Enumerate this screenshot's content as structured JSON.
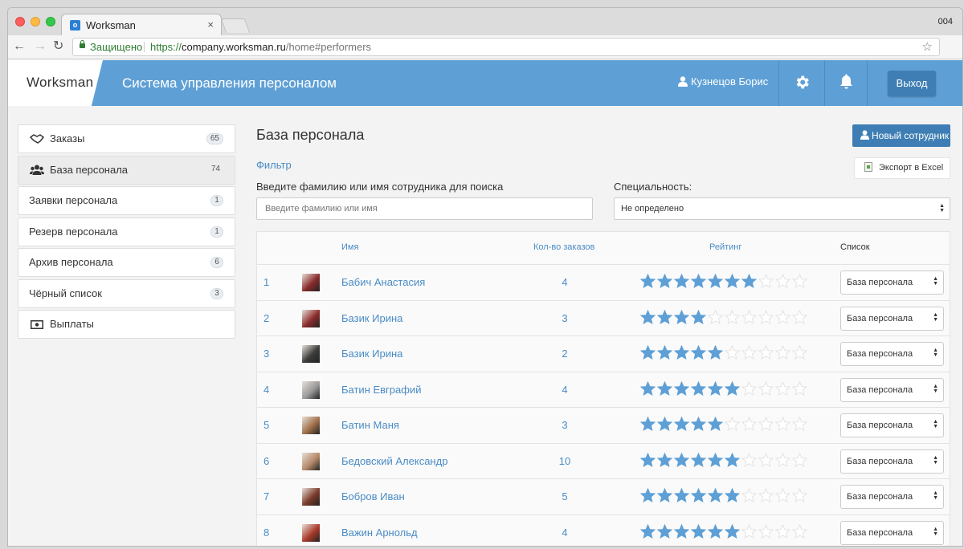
{
  "browser": {
    "tab_title": "Worksman",
    "tab_close": "×",
    "window_label": "004",
    "secure_label": "Защищено",
    "url_proto": "https://",
    "url_host": "company.worksman.ru",
    "url_path": "/home#performers"
  },
  "header": {
    "logo": "Worksman",
    "title": "Система управления персоналом",
    "user_name": "Кузнецов Борис",
    "logout_label": "Выход",
    "accent_color": "#5ea0d6"
  },
  "sidebar": {
    "items": [
      {
        "label": "Заказы",
        "icon": "handshake-icon",
        "badge": "65",
        "active": false
      },
      {
        "label": "База персонала",
        "icon": "users-icon",
        "badge": "74",
        "active": true
      },
      {
        "label": "Заявки персонала",
        "icon": "",
        "badge": "1",
        "active": false
      },
      {
        "label": "Резерв персонала",
        "icon": "",
        "badge": "1",
        "active": false
      },
      {
        "label": "Архив персонала",
        "icon": "",
        "badge": "6",
        "active": false
      },
      {
        "label": "Чёрный список",
        "icon": "",
        "badge": "3",
        "active": false
      },
      {
        "label": "Выплаты",
        "icon": "money-icon",
        "badge": "",
        "active": false
      }
    ]
  },
  "main": {
    "title": "База персонала",
    "new_button": "Новый сотрудник",
    "export_button": "Экспорт в Excel",
    "filter_link": "Фильтр",
    "search_label": "Введите фамилию или имя сотрудника для поиска",
    "search_placeholder": "Введите фамилию или имя",
    "specialty_label": "Специальность:",
    "specialty_value": "Не определено"
  },
  "table": {
    "columns": {
      "name": "Имя",
      "orders": "Кол-во заказов",
      "rating": "Рейтинг",
      "list": "Список"
    },
    "max_rating": 10,
    "star_color": "#5ea0d6",
    "rows": [
      {
        "num": "1",
        "name": "Бабич Анастасия",
        "orders": "4",
        "rating": 7,
        "list": "База персонала",
        "avatar_color": "#8a2b2b"
      },
      {
        "num": "2",
        "name": "Базик Ирина",
        "orders": "3",
        "rating": 4,
        "list": "База персонала",
        "avatar_color": "#8a2b2b"
      },
      {
        "num": "3",
        "name": "Базик Ирина",
        "orders": "2",
        "rating": 5,
        "list": "База персонала",
        "avatar_color": "#3b3b3b"
      },
      {
        "num": "4",
        "name": "Батин Евграфий",
        "orders": "4",
        "rating": 6,
        "list": "База персонала",
        "avatar_color": "#9a9a9a"
      },
      {
        "num": "5",
        "name": "Батин Маня",
        "orders": "3",
        "rating": 5,
        "list": "База персонала",
        "avatar_color": "#a0704a"
      },
      {
        "num": "6",
        "name": "Бедовский Александр",
        "orders": "10",
        "rating": 6,
        "list": "База персонала",
        "avatar_color": "#b58a6a"
      },
      {
        "num": "7",
        "name": "Бобров Иван",
        "orders": "5",
        "rating": 6,
        "list": "База персонала",
        "avatar_color": "#7a3a2a"
      },
      {
        "num": "8",
        "name": "Важин Арнольд",
        "orders": "4",
        "rating": 6,
        "list": "База персонала",
        "avatar_color": "#a83a2a"
      }
    ]
  }
}
